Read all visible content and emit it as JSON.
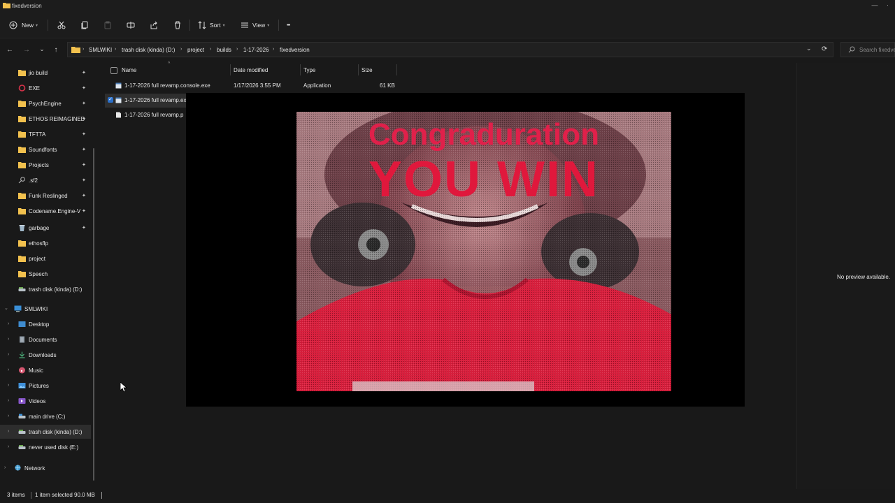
{
  "window": {
    "title": "fixedversion",
    "minimize_glyph": "—",
    "close_glyph": "·"
  },
  "toolbar": {
    "new_label": "New",
    "sort_label": "Sort",
    "view_label": "View",
    "more_glyph": "•••",
    "icons": [
      "cut-icon",
      "copy-icon",
      "paste-icon",
      "rename-icon",
      "share-icon",
      "delete-icon"
    ]
  },
  "nav": {
    "back": "←",
    "forward": "→",
    "recent": "⌄",
    "up": "↑",
    "refresh": "⟳",
    "dropdown": "⌄"
  },
  "breadcrumb": [
    "SMLWIKI",
    "trash disk (kinda) (D:)",
    "project",
    "builds",
    "1-17-2026",
    "fixedversion"
  ],
  "search": {
    "placeholder": "Search fixedversion"
  },
  "sidebar": {
    "quick_access": [
      {
        "label": "jio build",
        "icon": "folder-icon"
      },
      {
        "label": "EXE",
        "icon": "exe-ring-icon"
      },
      {
        "label": "PsychEngine",
        "icon": "folder-icon"
      },
      {
        "label": "ETHOS REIMAGINED",
        "icon": "folder-icon"
      },
      {
        "label": "TFTTA",
        "icon": "folder-icon"
      },
      {
        "label": "Soundfonts",
        "icon": "folder-icon"
      },
      {
        "label": "Projects",
        "icon": "folder-icon"
      },
      {
        "label": ".sf2",
        "icon": "magnifier-icon"
      },
      {
        "label": "Funk Reslinged",
        "icon": "folder-icon"
      },
      {
        "label": "Codename.Engine-V",
        "icon": "folder-icon"
      }
    ],
    "recent": [
      {
        "label": "garbage",
        "icon": "recycle-bin-icon"
      },
      {
        "label": "ethosflp",
        "icon": "folder-icon"
      },
      {
        "label": "project",
        "icon": "folder-icon"
      },
      {
        "label": "Speech",
        "icon": "folder-icon"
      },
      {
        "label": "trash disk (kinda) (D:)",
        "icon": "drive-icon"
      }
    ],
    "this_pc": {
      "label": "SMLWIKI",
      "icon": "computer-icon"
    },
    "pc_items": [
      {
        "label": "Desktop",
        "icon": "desktop-icon"
      },
      {
        "label": "Documents",
        "icon": "documents-icon"
      },
      {
        "label": "Downloads",
        "icon": "downloads-icon"
      },
      {
        "label": "Music",
        "icon": "music-icon"
      },
      {
        "label": "Pictures",
        "icon": "pictures-icon"
      },
      {
        "label": "Videos",
        "icon": "videos-icon"
      },
      {
        "label": "main drive (C:)",
        "icon": "drive-icon"
      },
      {
        "label": "trash disk (kinda) (D:)",
        "icon": "drive-icon"
      },
      {
        "label": "never used disk (E:)",
        "icon": "drive-icon"
      }
    ],
    "network": {
      "label": "Network",
      "icon": "network-icon"
    },
    "pin_glyph": "📌"
  },
  "columns": {
    "name": "Name",
    "date_modified": "Date modified",
    "type": "Type",
    "size": "Size"
  },
  "files": [
    {
      "name": "1-17-2026 full revamp.console.exe",
      "date": "1/17/2026 3:55 PM",
      "type": "Application",
      "size": "61 KB",
      "selected": false
    },
    {
      "name": "1-17-2026 full revamp.ex",
      "selected": true
    },
    {
      "name": "1-17-2026 full revamp.p",
      "selected": false
    }
  ],
  "preview": {
    "message": "No preview available."
  },
  "popup": {
    "line1": "Congraduration",
    "line2": "YOU WIN"
  },
  "status": {
    "items": "3 items",
    "selection": "1 item selected  90.0 MB"
  },
  "colors": {
    "accent_red": "#e0204a",
    "folder_yellow": "#f2c14e",
    "background": "#191919"
  }
}
